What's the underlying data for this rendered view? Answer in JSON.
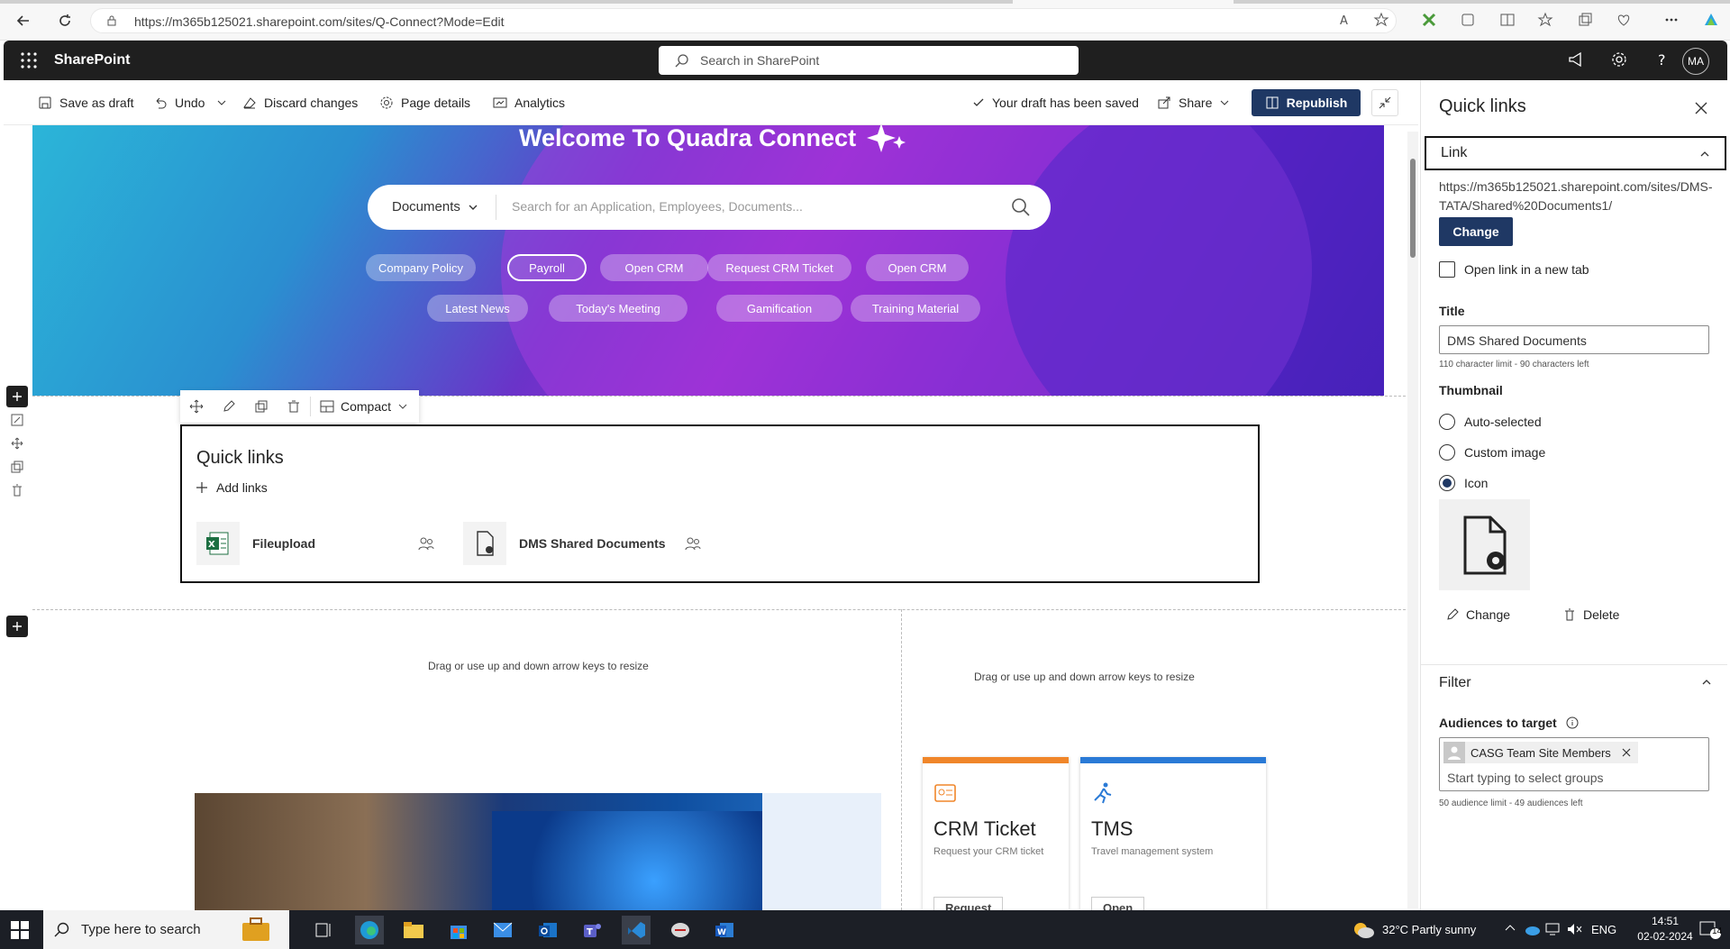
{
  "browser": {
    "url": "https://m365b125021.sharepoint.com/sites/Q-Connect?Mode=Edit"
  },
  "sharepoint": {
    "app_title": "SharePoint",
    "search_placeholder": "Search in SharePoint",
    "avatar_initials": "MA"
  },
  "command_bar": {
    "save_draft": "Save as draft",
    "undo": "Undo",
    "discard": "Discard changes",
    "page_details": "Page details",
    "analytics": "Analytics",
    "draft_status": "Your draft has been saved",
    "share": "Share",
    "republish": "Republish"
  },
  "hero": {
    "title": "Welcome To Quadra Connect",
    "search_scope": "Documents",
    "search_placeholder": "Search for an Application, Employees, Documents...",
    "pills_row1": [
      "Company Policy",
      "Payroll",
      "Open CRM",
      "Request CRM Ticket",
      "Open CRM"
    ],
    "pills_row2": [
      "Latest News",
      "Today's Meeting",
      "Gamification",
      "Training Material"
    ]
  },
  "webpart_toolbar": {
    "layout": "Compact"
  },
  "quick_links": {
    "title": "Quick links",
    "add_links": "Add links",
    "items": [
      {
        "label": "Fileupload",
        "icon": "excel-icon"
      },
      {
        "label": "DMS Shared Documents",
        "icon": "document-settings-icon"
      }
    ]
  },
  "resize_hint": "Drag or use up and down arrow keys to resize",
  "cards": [
    {
      "title": "CRM Ticket",
      "subtitle": "Request your CRM ticket",
      "button": "Request",
      "accent": "#f0862a"
    },
    {
      "title": "TMS",
      "subtitle": "Travel management system",
      "button": "Open",
      "accent": "#2a7ad6"
    }
  ],
  "panel": {
    "title": "Quick links",
    "link_section": "Link",
    "link_url": "https://m365b125021.sharepoint.com/sites/DMS-TATA/Shared%20Documents1/",
    "change_button": "Change",
    "open_new_tab": "Open link in a new tab",
    "title_label": "Title",
    "title_value": "DMS Shared Documents",
    "title_hint": "110 character limit - 90 characters left",
    "thumbnail_label": "Thumbnail",
    "thumbnail_options": [
      "Auto-selected",
      "Custom image",
      "Icon"
    ],
    "thumbnail_selected": "Icon",
    "icon_change": "Change",
    "icon_delete": "Delete",
    "filter_section": "Filter",
    "audiences_label": "Audiences to target",
    "audience_tag": "CASG Team Site Members",
    "audience_placeholder": "Start typing to select groups",
    "audience_hint": "50 audience limit - 49 audiences left"
  },
  "taskbar": {
    "search_placeholder": "Type here to search",
    "weather": "32°C  Partly sunny",
    "lang": "ENG",
    "time": "14:51",
    "date": "02-02-2024",
    "notif_count": "14"
  },
  "colors": {
    "accent_dark": "#1f3864",
    "crm_accent": "#f0862a",
    "tms_accent": "#2a7ad6"
  }
}
